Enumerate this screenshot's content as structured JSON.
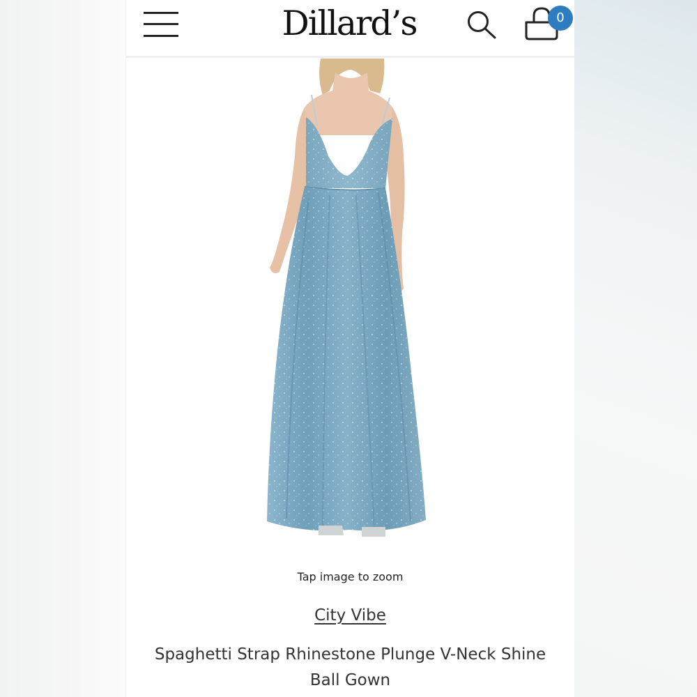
{
  "header": {
    "logo_text": "Dillard’s",
    "cart_count": "0",
    "menu_icon": "hamburger-menu-icon",
    "search_icon": "search-icon",
    "cart_icon": "shopping-bag-icon",
    "badge_color": "#2d7dc0"
  },
  "product": {
    "image_hint": "Tap image to zoom",
    "brand": "City Vibe",
    "name": "Spaghetti Strap Rhinestone Plunge V-Neck Shine Ball Gown",
    "dress_color": "#7fa9c0"
  }
}
